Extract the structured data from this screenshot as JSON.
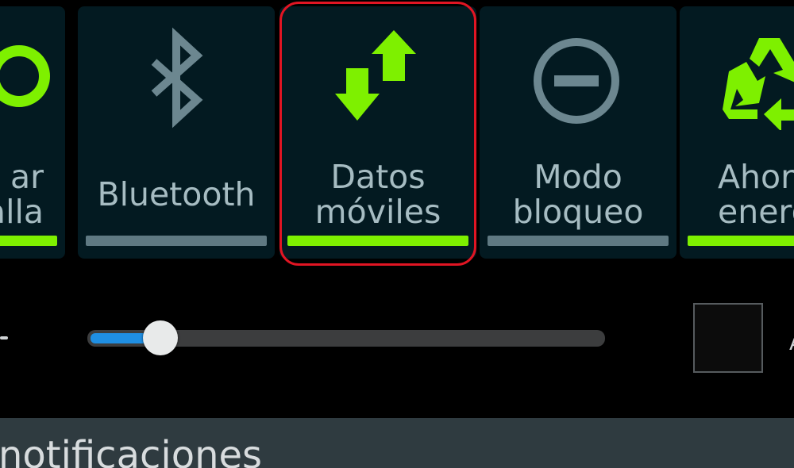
{
  "quick_settings": {
    "tiles": [
      {
        "lines": [
          "ar",
          "alla"
        ],
        "active": true,
        "icon": "rotate-screen-icon"
      },
      {
        "lines": [
          "Bluetooth"
        ],
        "active": false,
        "icon": "bluetooth-icon"
      },
      {
        "lines": [
          "Datos",
          "móviles"
        ],
        "active": true,
        "icon": "mobile-data-arrows-icon",
        "highlighted": true
      },
      {
        "lines": [
          "Modo",
          "bloqueo"
        ],
        "active": false,
        "icon": "block-mode-icon"
      },
      {
        "lines": [
          "Ahor",
          "energ"
        ],
        "active": true,
        "icon": "power-saving-recycle-icon"
      }
    ]
  },
  "brightness": {
    "level": 0.13,
    "auto_glyph": "A"
  },
  "notifications": {
    "label": "notificaciones"
  },
  "colors": {
    "tile_bg": "#031a21",
    "active": "#7ef000",
    "inactive": "#5f7982",
    "highlight": "#e11523",
    "slider_fill": "#1f8fe3"
  }
}
